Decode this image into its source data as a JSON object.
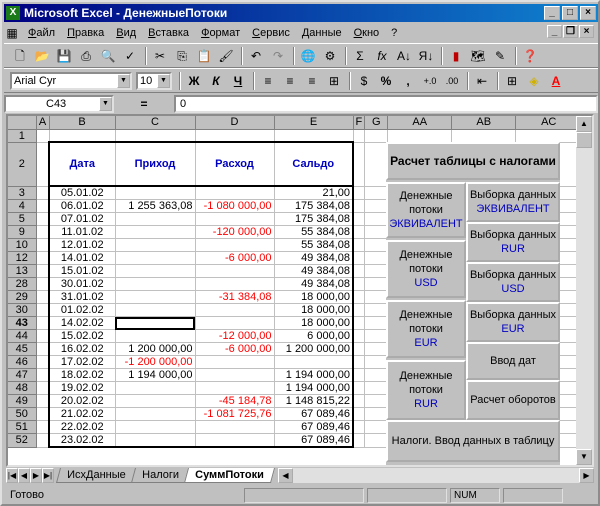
{
  "window": {
    "title": "Microsoft Excel - ДенежныеПотоки",
    "app_icon": "excel-icon"
  },
  "menu": [
    "Файл",
    "Правка",
    "Вид",
    "Вставка",
    "Формат",
    "Сервис",
    "Данные",
    "Окно",
    "?"
  ],
  "toolbar": {
    "font_name": "Arial Cyr",
    "font_size": "10",
    "bold": "Ж",
    "italic": "К",
    "underline": "Ч",
    "percent": "%",
    "comma": ",",
    "sum": "Σ",
    "fx": "fx"
  },
  "formula_bar": {
    "name_box": "C43",
    "eq": "=",
    "value": "0"
  },
  "columns": [
    "A",
    "B",
    "C",
    "D",
    "E",
    "F",
    "G",
    "AA",
    "AB",
    "AC"
  ],
  "headers": {
    "date": "Дата",
    "income": "Приход",
    "expense": "Расход",
    "balance": "Сальдо"
  },
  "rows": [
    {
      "n": "1",
      "date": "",
      "income": "",
      "expense": "",
      "balance": ""
    },
    {
      "n": "3",
      "date": "05.01.02",
      "income": "",
      "expense": "",
      "balance": "21,00"
    },
    {
      "n": "4",
      "date": "06.01.02",
      "income": "1 255 363,08",
      "expense": "-1 080 000,00",
      "balance": "175 384,08"
    },
    {
      "n": "5",
      "date": "07.01.02",
      "income": "",
      "expense": "",
      "balance": "175 384,08"
    },
    {
      "n": "9",
      "date": "11.01.02",
      "income": "",
      "expense": "-120 000,00",
      "balance": "55 384,08"
    },
    {
      "n": "10",
      "date": "12.01.02",
      "income": "",
      "expense": "",
      "balance": "55 384,08"
    },
    {
      "n": "12",
      "date": "14.01.02",
      "income": "",
      "expense": "-6 000,00",
      "balance": "49 384,08"
    },
    {
      "n": "13",
      "date": "15.01.02",
      "income": "",
      "expense": "",
      "balance": "49 384,08"
    },
    {
      "n": "28",
      "date": "30.01.02",
      "income": "",
      "expense": "",
      "balance": "49 384,08"
    },
    {
      "n": "29",
      "date": "31.01.02",
      "income": "",
      "expense": "-31 384,08",
      "balance": "18 000,00"
    },
    {
      "n": "30",
      "date": "01.02.02",
      "income": "",
      "expense": "",
      "balance": "18 000,00"
    },
    {
      "n": "43",
      "date": "14.02.02",
      "income": "",
      "expense": "",
      "balance": "18 000,00"
    },
    {
      "n": "44",
      "date": "15.02.02",
      "income": "",
      "expense": "-12 000,00",
      "balance": "6 000,00"
    },
    {
      "n": "45",
      "date": "16.02.02",
      "income": "1 200 000,00",
      "expense": "-6 000,00",
      "balance": "1 200 000,00"
    },
    {
      "n": "46",
      "date": "17.02.02",
      "income": "-1 200 000,00",
      "expense": "",
      "balance": ""
    },
    {
      "n": "47",
      "date": "18.02.02",
      "income": "1 194 000,00",
      "expense": "",
      "balance": "1 194 000,00"
    },
    {
      "n": "48",
      "date": "19.02.02",
      "income": "",
      "expense": "",
      "balance": "1 194 000,00"
    },
    {
      "n": "49",
      "date": "20.02.02",
      "income": "",
      "expense": "-45 184,78",
      "balance": "1 148 815,22"
    },
    {
      "n": "50",
      "date": "21.02.02",
      "income": "",
      "expense": "-1 081 725,76",
      "balance": "67 089,46"
    },
    {
      "n": "51",
      "date": "22.02.02",
      "income": "",
      "expense": "",
      "balance": "67 089,46"
    },
    {
      "n": "52",
      "date": "23.02.02",
      "income": "",
      "expense": "",
      "balance": "67 089,46"
    }
  ],
  "header_row_num": "2",
  "panel": {
    "title": "Расчет таблицы с налогами",
    "cf_equiv_top": "Денежные потоки",
    "cf_equiv_sub": "ЭКВИВАЛЕНТ",
    "sel_equiv_top": "Выборка данных",
    "sel_equiv_sub": "ЭКВИВАЛЕНТ",
    "sel_rur_top": "Выборка данных",
    "sel_rur_sub": "RUR",
    "cf_usd_top": "Денежные потоки",
    "cf_usd_sub": "USD",
    "sel_usd_top": "Выборка данных",
    "sel_usd_sub": "USD",
    "cf_eur_top": "Денежные потоки",
    "cf_eur_sub": "EUR",
    "sel_eur_top": "Выборка данных",
    "sel_eur_sub": "EUR",
    "input_dates": "Ввод дат",
    "cf_rur_top": "Денежные потоки",
    "cf_rur_sub": "RUR",
    "turnover": "Расчет оборотов",
    "taxes": "Налоги. Ввод данных в таблицу"
  },
  "sheet_tabs": [
    "ИсхДанные",
    "Налоги",
    "СуммПотоки"
  ],
  "active_tab": "СуммПотоки",
  "status": {
    "ready": "Готово",
    "num": "NUM"
  }
}
